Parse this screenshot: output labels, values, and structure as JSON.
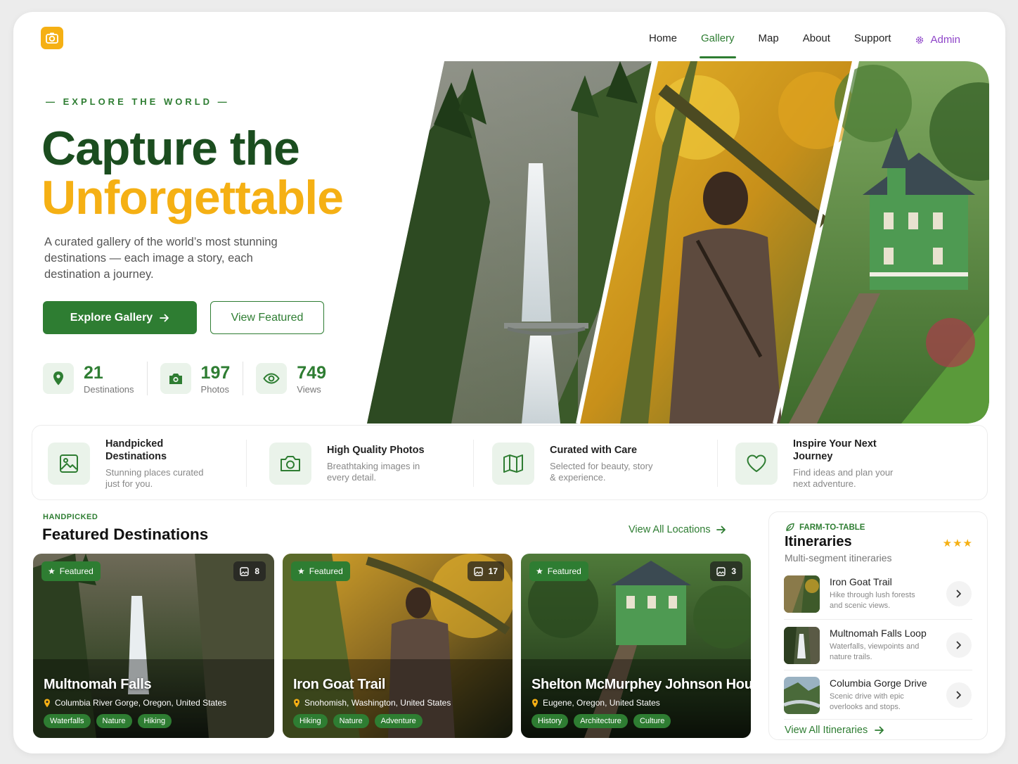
{
  "nav": {
    "items": [
      "Home",
      "Gallery",
      "Map",
      "About",
      "Support"
    ],
    "active": "Gallery",
    "admin_label": "Admin"
  },
  "hero": {
    "eyebrow": "— EXPLORE THE WORLD —",
    "title_line1": "Capture the",
    "title_line2": "Unforgettable",
    "lead": "A curated gallery of the world’s most stunning destinations — each image a story, each destination a journey.",
    "primary_button": "Explore Gallery",
    "secondary_button": "View Featured",
    "stats": [
      {
        "icon": "map-pin-icon",
        "value": "21",
        "label": "Destinations"
      },
      {
        "icon": "camera-icon",
        "value": "197",
        "label": "Photos"
      },
      {
        "icon": "eye-icon",
        "value": "749",
        "label": "Views"
      }
    ]
  },
  "features": [
    {
      "icon": "image-icon",
      "title": "Handpicked Destinations",
      "desc": "Stunning places curated just for you."
    },
    {
      "icon": "camera-icon",
      "title": "High Quality Photos",
      "desc": "Breathtaking images in every detail."
    },
    {
      "icon": "map-icon",
      "title": "Curated with Care",
      "desc": "Selected for beauty, story & experience."
    },
    {
      "icon": "heart-icon",
      "title": "Inspire Your Next Journey",
      "desc": "Find ideas and plan your next adventure."
    }
  ],
  "featured": {
    "eyebrow": "HANDPICKED",
    "title": "Featured Destinations",
    "view_all": "View All Locations",
    "badge_label": "Featured",
    "cards": [
      {
        "title": "Multnomah Falls",
        "location": "Columbia River Gorge, Oregon, United States",
        "count": "8",
        "tags": [
          "Waterfalls",
          "Nature",
          "Hiking"
        ]
      },
      {
        "title": "Iron Goat Trail",
        "location": "Snohomish, Washington, United States",
        "count": "17",
        "tags": [
          "Hiking",
          "Nature",
          "Adventure"
        ]
      },
      {
        "title": "Shelton McMurphey Johnson House",
        "location": "Eugene, Oregon, United States",
        "count": "3",
        "tags": [
          "History",
          "Architecture",
          "Culture"
        ]
      }
    ]
  },
  "itineraries": {
    "eyebrow": "FARM-TO-TABLE",
    "title": "Itineraries",
    "stars": "★★★",
    "subtitle": "Multi-segment itineraries",
    "items": [
      {
        "name": "Iron Goat Trail",
        "desc": "Hike through lush forests and scenic views."
      },
      {
        "name": "Multnomah Falls Loop",
        "desc": "Waterfalls, viewpoints and nature trails."
      },
      {
        "name": "Columbia Gorge Drive",
        "desc": "Scenic drive with epic overlooks and stops."
      }
    ],
    "view_all": "View All Itineraries"
  },
  "colors": {
    "brand_green": "#2e7d32",
    "dark_green": "#1b4d1f",
    "accent_yellow": "#f5b014",
    "admin_purple": "#8e44c8"
  }
}
